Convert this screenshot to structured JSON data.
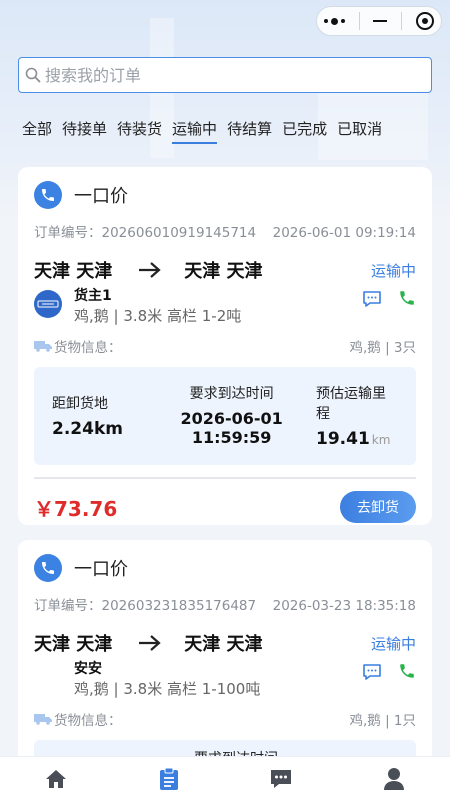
{
  "search": {
    "placeholder": "搜索我的订单"
  },
  "tabs": [
    {
      "label": "全部"
    },
    {
      "label": "待接单"
    },
    {
      "label": "待装货"
    },
    {
      "label": "运输中"
    },
    {
      "label": "待结算"
    },
    {
      "label": "已完成"
    },
    {
      "label": "已取消"
    }
  ],
  "active_tab": "运输中",
  "orders": [
    {
      "price_type": "一口价",
      "order_no": "订单编号：202606010919145714",
      "datetime": "2026-06-01 09:19:14",
      "from_city": "天津 天津",
      "to_city": "天津 天津",
      "status": "运输中",
      "owner_name": "货主1",
      "truck_info": "鸡,鹅 | 3.8米 高栏 1-2吨",
      "goods_label": "货物信息：",
      "goods_value": "鸡,鹅 | 3只",
      "dist_label": "距卸货地",
      "dist_value": "2.24km",
      "arrive_label": "要求到达时间",
      "arrive_date": "2026-06-01",
      "arrive_time": "11:59:59",
      "mileage_label": "预估运输里程",
      "mileage_value": "19.41",
      "mileage_unit": "km",
      "amount": "￥73.76",
      "action_label": "去卸货"
    },
    {
      "price_type": "一口价",
      "order_no": "订单编号：202603231835176487",
      "datetime": "2026-03-23 18:35:18",
      "from_city": "天津 天津",
      "to_city": "天津 天津",
      "status": "运输中",
      "owner_name": "安安",
      "truck_info": "鸡,鹅 | 3.8米 高栏 1-100吨",
      "goods_label": "货物信息：",
      "goods_value": "鸡,鹅 | 1只",
      "arrive_label_partial": "要求到达时间"
    }
  ],
  "colors": {
    "accent": "#3a7ee0",
    "price": "#e02b2b",
    "green": "#2bb24c"
  }
}
